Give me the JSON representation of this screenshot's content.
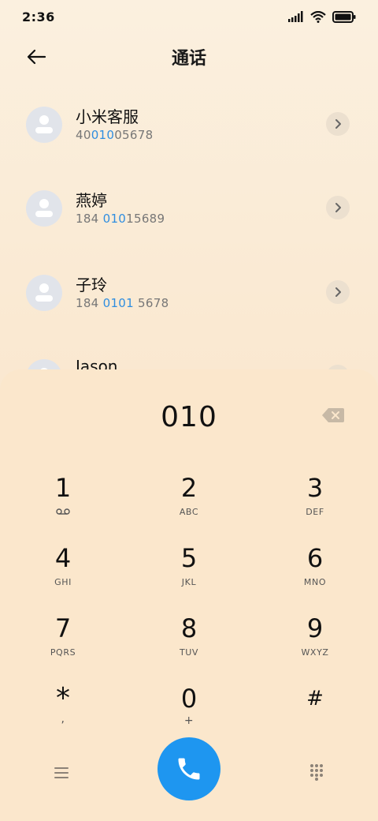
{
  "status_bar": {
    "time": "2:36"
  },
  "header": {
    "title": "通话"
  },
  "contacts": [
    {
      "name": "小米客服",
      "number_pre": "40",
      "number_hl": "010",
      "number_post": "05678"
    },
    {
      "name": "燕婷",
      "number_pre": "184 ",
      "number_hl": "010",
      "number_post": "15689"
    },
    {
      "name": "子玲",
      "number_pre": "184 ",
      "number_hl": "0101",
      "number_post": " 5678"
    },
    {
      "name": "Jason",
      "number_pre": "",
      "number_hl": "",
      "number_post": ""
    }
  ],
  "dialer": {
    "input": "010"
  },
  "keys": [
    {
      "digit": "1",
      "letters": ""
    },
    {
      "digit": "2",
      "letters": "ABC"
    },
    {
      "digit": "3",
      "letters": "DEF"
    },
    {
      "digit": "4",
      "letters": "GHI"
    },
    {
      "digit": "5",
      "letters": "JKL"
    },
    {
      "digit": "6",
      "letters": "MNO"
    },
    {
      "digit": "7",
      "letters": "PQRS"
    },
    {
      "digit": "8",
      "letters": "TUV"
    },
    {
      "digit": "9",
      "letters": "WXYZ"
    },
    {
      "digit": "*",
      "letters": ","
    },
    {
      "digit": "0",
      "letters": "+"
    },
    {
      "digit": "#",
      "letters": ""
    }
  ],
  "colors": {
    "accent": "#1e96f0",
    "highlight": "#2f8ee0",
    "sheet": "#fbe7cc"
  },
  "icons": {
    "back": "arrow-left-icon",
    "detail": "chevron-right-icon",
    "backspace": "backspace-icon",
    "voicemail": "voicemail-icon",
    "menu": "menu-icon",
    "call": "phone-icon",
    "keypad": "dialpad-icon"
  }
}
